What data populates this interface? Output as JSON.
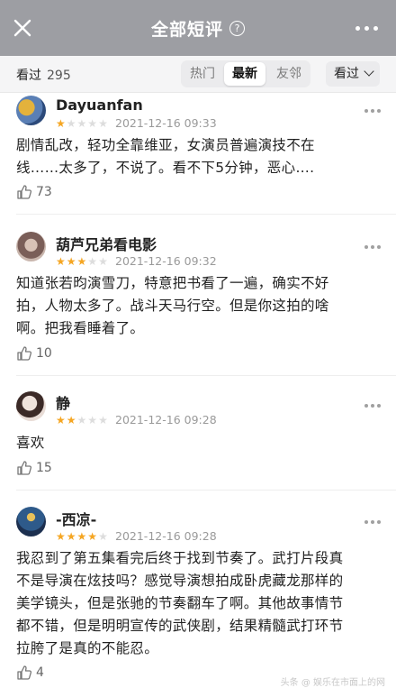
{
  "header": {
    "title": "全部短评",
    "help_glyph": "?"
  },
  "filter": {
    "seen_label": "看过",
    "seen_count": "295",
    "tabs": [
      "热门",
      "最新",
      "友邻"
    ],
    "active_tab": "最新",
    "dropdown_label": "看过"
  },
  "reviews": [
    {
      "user": "Dayuanfan",
      "rating": 1,
      "date": "2021-12-16 09:33",
      "lines": [
        "剧情乱改，轻功全靠维亚，女演员普遍演技不在",
        "线……太多了，不说了。看不下5分钟，恶心…."
      ],
      "likes": "73"
    },
    {
      "user": "葫芦兄弟看电影",
      "rating": 3,
      "date": "2021-12-16 09:32",
      "lines": [
        "知道张若昀演雪刀，特意把书看了一遍，确实不好",
        "拍，人物太多了。战斗天马行空。但是你这拍的啥",
        "啊。把我看睡着了。"
      ],
      "likes": "10"
    },
    {
      "user": "静",
      "rating": 2,
      "date": "2021-12-16 09:28",
      "lines": [
        "喜欢"
      ],
      "likes": "15"
    },
    {
      "user": "-西凉-",
      "rating": 4,
      "date": "2021-12-16 09:28",
      "lines": [
        "我忍到了第五集看完后终于找到节奏了。武打片段真",
        "不是导演在炫技吗？感觉导演想拍成卧虎藏龙那样的",
        "美学镜头，但是张驰的节奏翻车了啊。其他故事情节",
        "都不错，但是明明宣传的武侠剧，结果精髓武打环节",
        "拉胯了是真的不能忍。"
      ],
      "likes": "4"
    }
  ],
  "colors": {
    "header_bg": "#9d9ea3",
    "star_on": "#f5a623",
    "star_off": "#dddddd"
  },
  "watermark": "头条 @ 娱乐在市面上的网"
}
